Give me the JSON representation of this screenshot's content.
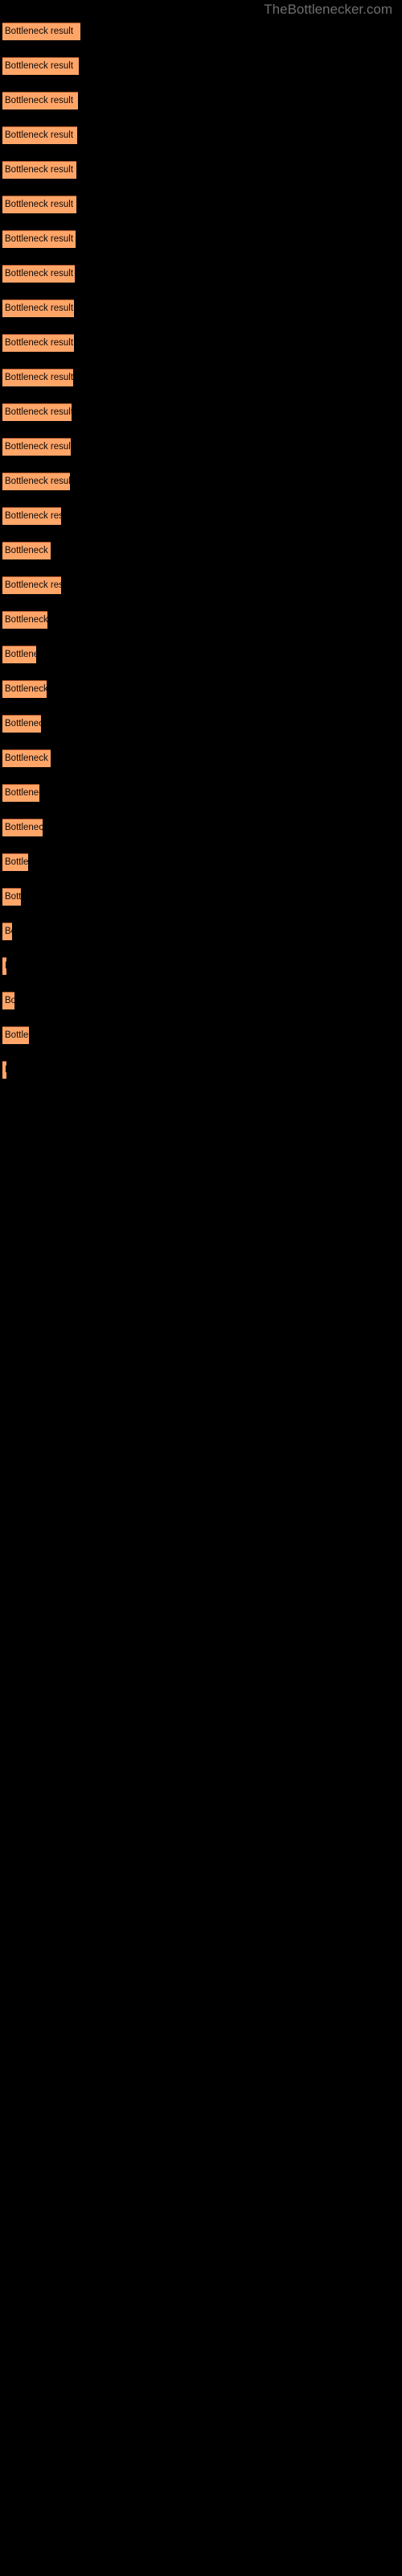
{
  "watermark": {
    "text": "TheBottlenecker.com"
  },
  "colors": {
    "background": "#000000",
    "bar_fill": "#ffa568",
    "bar_border_top": "#b3592b",
    "label_text": "#0b0b0b",
    "watermark_text": "#6e6e6e"
  },
  "chart_data": {
    "type": "bar",
    "orientation": "horizontal",
    "title": "",
    "subtitle": "",
    "xlabel": "",
    "ylabel": "",
    "grid": false,
    "legend": null,
    "bar_label_text": "Bottleneck result",
    "categories": [
      "Bottleneck result",
      "Bottleneck result",
      "Bottleneck result",
      "Bottleneck result",
      "Bottleneck result",
      "Bottleneck result",
      "Bottleneck result",
      "Bottleneck result",
      "Bottleneck result",
      "Bottleneck result",
      "Bottleneck result",
      "Bottleneck result",
      "Bottleneck result",
      "Bottleneck result",
      "Bottleneck result",
      "Bottleneck result",
      "Bottleneck result",
      "Bottleneck result",
      "Bottleneck result",
      "Bottleneck result",
      "Bottleneck result",
      "Bottleneck result",
      "Bottleneck result",
      "Bottleneck result",
      "Bottleneck result",
      "Bottleneck result",
      "Bottleneck result",
      "Bottleneck result",
      "Bottleneck result",
      "Bottleneck result",
      "Bottleneck result"
    ],
    "values": [
      97,
      95,
      94,
      93,
      92,
      92,
      91,
      90,
      89,
      89,
      88,
      86,
      85,
      84,
      73,
      60,
      73,
      56,
      42,
      55,
      48,
      60,
      46,
      50,
      32,
      23,
      12,
      5,
      15,
      33,
      5
    ],
    "xlim": [
      0,
      100
    ],
    "bars": [
      {
        "y": 28,
        "width": 97,
        "label": "Bottleneck result"
      },
      {
        "y": 71,
        "width": 95,
        "label": "Bottleneck result"
      },
      {
        "y": 114,
        "width": 94,
        "label": "Bottleneck result"
      },
      {
        "y": 157,
        "width": 93,
        "label": "Bottleneck result"
      },
      {
        "y": 200,
        "width": 92,
        "label": "Bottleneck result"
      },
      {
        "y": 243,
        "width": 92,
        "label": "Bottleneck result"
      },
      {
        "y": 286,
        "width": 91,
        "label": "Bottleneck result"
      },
      {
        "y": 329,
        "width": 90,
        "label": "Bottleneck result"
      },
      {
        "y": 372,
        "width": 89,
        "label": "Bottleneck result"
      },
      {
        "y": 415,
        "width": 89,
        "label": "Bottleneck result"
      },
      {
        "y": 458,
        "width": 88,
        "label": "Bottleneck result"
      },
      {
        "y": 501,
        "width": 86,
        "label": "Bottleneck result"
      },
      {
        "y": 544,
        "width": 85,
        "label": "Bottleneck result"
      },
      {
        "y": 587,
        "width": 84,
        "label": "Bottleneck result"
      },
      {
        "y": 630,
        "width": 73,
        "label": "Bottleneck result"
      },
      {
        "y": 673,
        "width": 60,
        "label": "Bottleneck result"
      },
      {
        "y": 716,
        "width": 73,
        "label": "Bottleneck result"
      },
      {
        "y": 759,
        "width": 56,
        "label": "Bottleneck result"
      },
      {
        "y": 802,
        "width": 42,
        "label": "Bottleneck result"
      },
      {
        "y": 845,
        "width": 55,
        "label": "Bottleneck result"
      },
      {
        "y": 888,
        "width": 48,
        "label": "Bottleneck result"
      },
      {
        "y": 931,
        "width": 60,
        "label": "Bottleneck result"
      },
      {
        "y": 974,
        "width": 46,
        "label": "Bottleneck result"
      },
      {
        "y": 1017,
        "width": 50,
        "label": "Bottleneck result"
      },
      {
        "y": 1060,
        "width": 32,
        "label": "Bottleneck result"
      },
      {
        "y": 1103,
        "width": 23,
        "label": "Bottleneck result"
      },
      {
        "y": 1146,
        "width": 12,
        "label": "Bottleneck result"
      },
      {
        "y": 1189,
        "width": 5,
        "label": "Bottleneck result"
      },
      {
        "y": 1232,
        "width": 15,
        "label": "Bottleneck result"
      },
      {
        "y": 1275,
        "width": 33,
        "label": "Bottleneck result"
      },
      {
        "y": 1318,
        "width": 5,
        "label": "Bottleneck result"
      }
    ]
  }
}
